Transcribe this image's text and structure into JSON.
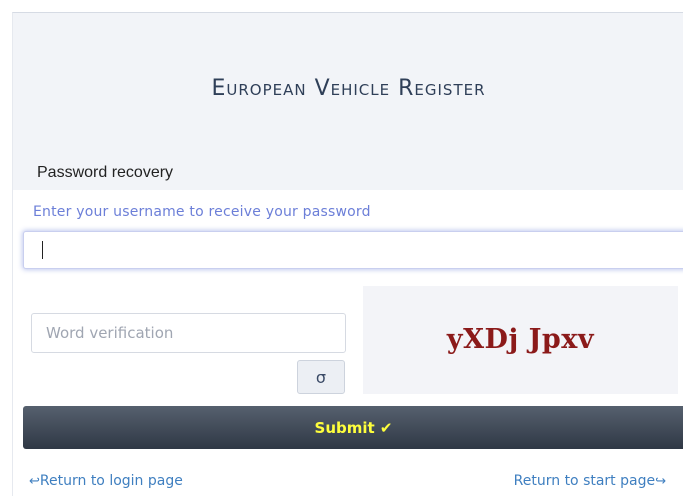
{
  "header": {
    "title": "European Vehicle Register"
  },
  "section": {
    "title": "Password recovery"
  },
  "form": {
    "username_hint": "Enter your username to receive your password",
    "username_value": "",
    "verification_placeholder": "Word verification",
    "verification_value": "",
    "refresh_label": "σ",
    "captcha_text": "yXDj Jpxv",
    "submit_label": "Submit ✔"
  },
  "links": {
    "login_label": "Return to login page",
    "login_icon": "return-arrow-left-icon",
    "start_label": "Return to start page",
    "start_icon": "return-arrow-right-icon"
  },
  "colors": {
    "title": "#2f3f58",
    "hint": "#6c7fd8",
    "captcha": "#8b1a1a",
    "submit_text": "#ffff3c",
    "link": "#3f7fc0"
  }
}
